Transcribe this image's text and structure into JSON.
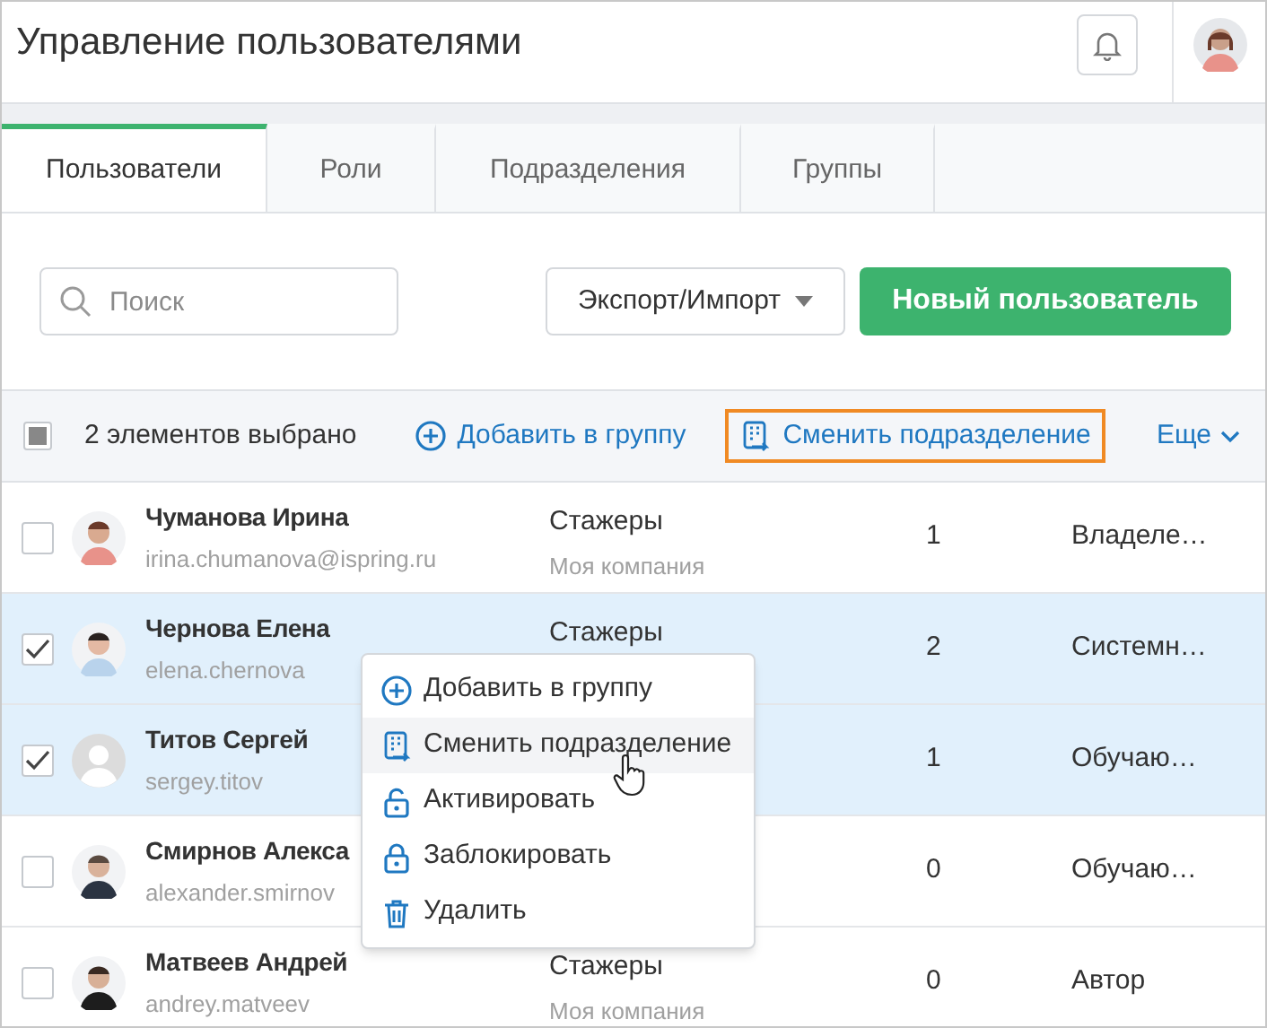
{
  "title": "Управление пользователями",
  "tabs": [
    {
      "label": "Пользователи",
      "selected": true
    },
    {
      "label": "Роли",
      "selected": false
    },
    {
      "label": "Подразделения",
      "selected": false
    },
    {
      "label": "Группы",
      "selected": false
    }
  ],
  "search": {
    "placeholder": "Поиск"
  },
  "export_button": "Экспорт/Импорт",
  "new_user_button": "Новый пользователь",
  "bulk_bar": {
    "select_all_indeterminate": true,
    "count": "2 элементов выбрано",
    "actions": [
      {
        "label": "Добавить в группу",
        "kind": "add",
        "focused": false
      },
      {
        "label": "Сменить подразделение",
        "kind": "move",
        "focused": true
      }
    ],
    "more": "Еще"
  },
  "rows": [
    {
      "name": "Чуманова Ирина",
      "email": "irina.chumanova@ispring.ru",
      "department": "Стажеры",
      "company": "Моя компания",
      "count": "1",
      "role": "Владеле…",
      "checked": false,
      "has_photo": true
    },
    {
      "name": "Чернова Елена",
      "email": "elena.chernova",
      "department": "Стажеры",
      "count": "2",
      "role": "Системн…",
      "checked": true,
      "has_photo": true
    },
    {
      "name": "Титов Сергей",
      "email": "sergey.titov",
      "count": "1",
      "role": "Обучаю…",
      "checked": true,
      "has_photo": false
    },
    {
      "name": "Смирнов Алекса",
      "email": "alexander.smirnov",
      "count": "0",
      "role": "Обучаю…",
      "checked": false,
      "has_photo": true
    },
    {
      "name": "Матвеев Андрей",
      "email": "andrey.matveev",
      "department": "Стажеры",
      "company": "Моя компания",
      "count": "0",
      "role": "Автор",
      "checked": false,
      "has_photo": true
    }
  ],
  "context_menu": [
    {
      "label": "Добавить в группу",
      "kind": "add",
      "hovered": false
    },
    {
      "label": "Сменить подразделение",
      "kind": "move",
      "hovered": true
    },
    {
      "label": "Активировать",
      "kind": "unlock",
      "hovered": false
    },
    {
      "label": "Заблокировать",
      "kind": "lock",
      "hovered": false
    },
    {
      "label": "Удалить",
      "kind": "delete",
      "hovered": false
    }
  ]
}
